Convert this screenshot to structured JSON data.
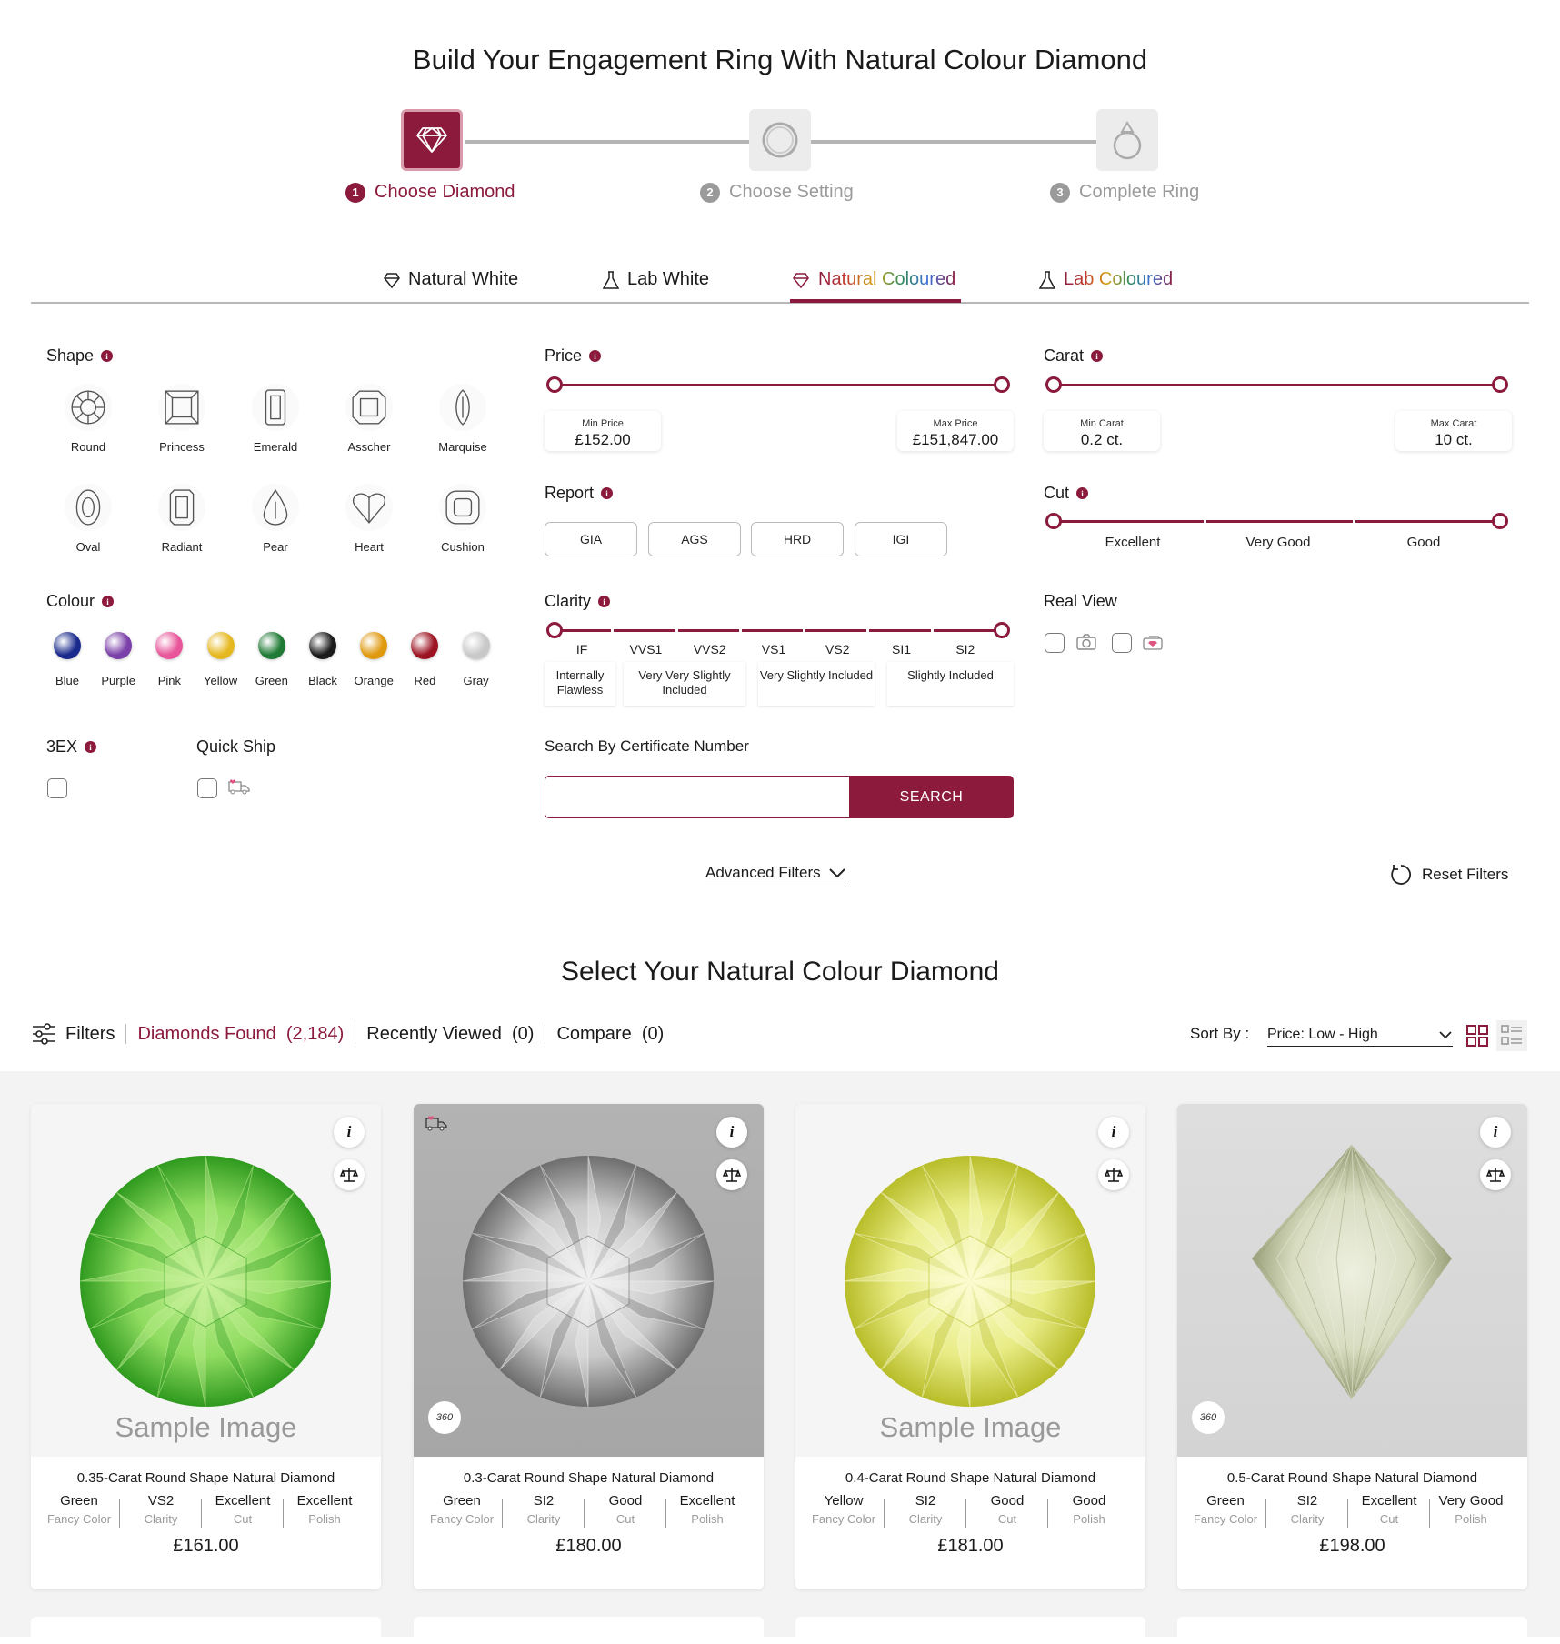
{
  "page_title": "Build Your Engagement Ring With Natural Colour Diamond",
  "steps": [
    {
      "num": "1",
      "label": "Choose Diamond"
    },
    {
      "num": "2",
      "label": "Choose Setting"
    },
    {
      "num": "3",
      "label": "Complete Ring"
    }
  ],
  "tabs": [
    "Natural White",
    "Lab White",
    "Natural Coloured",
    "Lab Coloured"
  ],
  "shape": {
    "title": "Shape",
    "items": [
      "Round",
      "Princess",
      "Emerald",
      "Asscher",
      "Marquise",
      "Oval",
      "Radiant",
      "Pear",
      "Heart",
      "Cushion"
    ]
  },
  "colour": {
    "title": "Colour",
    "items": [
      {
        "name": "Blue",
        "color": "#1a2a8c"
      },
      {
        "name": "Purple",
        "color": "#7a3fa8"
      },
      {
        "name": "Pink",
        "color": "#e8559a"
      },
      {
        "name": "Yellow",
        "color": "#e6b820"
      },
      {
        "name": "Green",
        "color": "#1e7a34"
      },
      {
        "name": "Black",
        "color": "#1a1a1a"
      },
      {
        "name": "Orange",
        "color": "#e09a10"
      },
      {
        "name": "Red",
        "color": "#9c1422"
      },
      {
        "name": "Gray",
        "color": "#c8c8c8"
      }
    ]
  },
  "three_ex": {
    "title": "3EX"
  },
  "quick_ship": {
    "title": "Quick Ship"
  },
  "price": {
    "title": "Price",
    "min_label": "Min Price",
    "min_value": "£152.00",
    "max_label": "Max Price",
    "max_value": "£151,847.00"
  },
  "carat": {
    "title": "Carat",
    "min_label": "Min Carat",
    "min_value": "0.2 ct.",
    "max_label": "Max Carat",
    "max_value": "10 ct."
  },
  "report": {
    "title": "Report",
    "options": [
      "GIA",
      "AGS",
      "HRD",
      "IGI"
    ]
  },
  "cut": {
    "title": "Cut",
    "ticks": [
      "Excellent",
      "Very Good",
      "Good"
    ]
  },
  "clarity": {
    "title": "Clarity",
    "ticks": [
      "IF",
      "VVS1",
      "VVS2",
      "VS1",
      "VS2",
      "SI1",
      "SI2"
    ],
    "groups": [
      "Internally Flawless",
      "Very Very Slightly Included",
      "Very Slightly Included",
      "Slightly Included"
    ]
  },
  "real_view": {
    "title": "Real View"
  },
  "certificate": {
    "title": "Search By Certificate Number",
    "placeholder": "",
    "button": "SEARCH"
  },
  "advanced_filters": "Advanced Filters",
  "reset_filters": "Reset Filters",
  "results_title": "Select Your Natural Colour Diamond",
  "toolbar": {
    "filters": "Filters",
    "found_label": "Diamonds Found",
    "found_count": "(2,184)",
    "recent_label": "Recently Viewed",
    "recent_count": "(0)",
    "compare_label": "Compare",
    "compare_count": "(0)",
    "sort_label": "Sort By :",
    "sort_value": "Price: Low - High"
  },
  "products": [
    {
      "title": "0.35-Carat Round Shape Natural Diamond",
      "price": "£161.00",
      "sample": "Sample Image",
      "specs": [
        {
          "v": "Green",
          "k": "Fancy Color"
        },
        {
          "v": "VS2",
          "k": "Clarity"
        },
        {
          "v": "Excellent",
          "k": "Cut"
        },
        {
          "v": "Excellent",
          "k": "Polish"
        }
      ]
    },
    {
      "title": "0.3-Carat Round Shape Natural Diamond",
      "price": "£180.00",
      "badge": "360",
      "specs": [
        {
          "v": "Green",
          "k": "Fancy Color"
        },
        {
          "v": "SI2",
          "k": "Clarity"
        },
        {
          "v": "Good",
          "k": "Cut"
        },
        {
          "v": "Excellent",
          "k": "Polish"
        }
      ]
    },
    {
      "title": "0.4-Carat Round Shape Natural Diamond",
      "price": "£181.00",
      "sample": "Sample Image",
      "specs": [
        {
          "v": "Yellow",
          "k": "Fancy Color"
        },
        {
          "v": "SI2",
          "k": "Clarity"
        },
        {
          "v": "Good",
          "k": "Cut"
        },
        {
          "v": "Good",
          "k": "Polish"
        }
      ]
    },
    {
      "title": "0.5-Carat Round Shape Natural Diamond",
      "price": "£198.00",
      "badge": "360",
      "specs": [
        {
          "v": "Green",
          "k": "Fancy Color"
        },
        {
          "v": "SI2",
          "k": "Clarity"
        },
        {
          "v": "Excellent",
          "k": "Cut"
        },
        {
          "v": "Very Good",
          "k": "Polish"
        }
      ]
    }
  ],
  "colors": {
    "accent": "#8b1a3c"
  }
}
